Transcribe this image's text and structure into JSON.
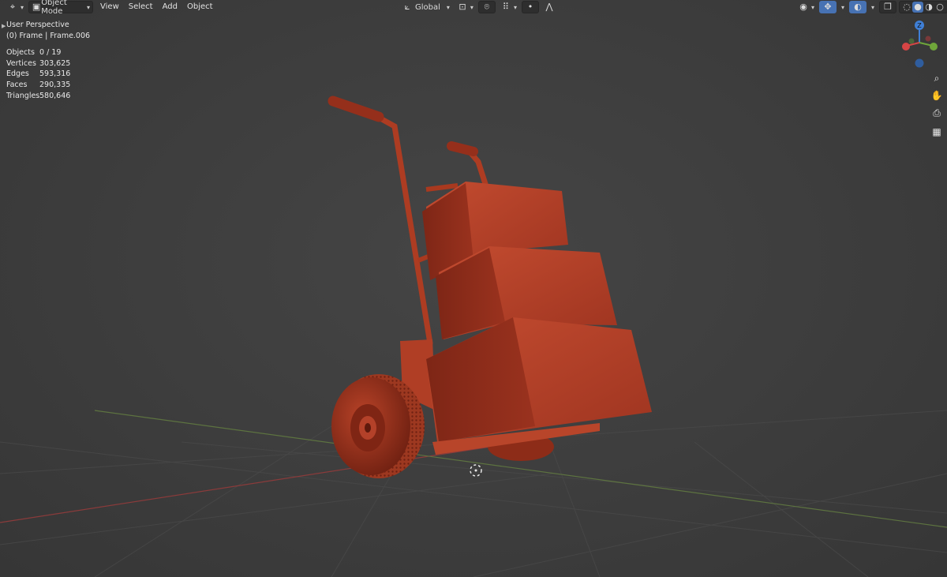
{
  "header": {
    "editor_type_icon": "view3d-icon",
    "mode": {
      "icon": "object-mode-icon",
      "label": "Object Mode"
    },
    "menus": [
      "View",
      "Select",
      "Add",
      "Object"
    ],
    "transform_orientation": {
      "icon": "orientation-icon",
      "label": "Global"
    },
    "icons_center": [
      "pivot-icon",
      "snap-icon",
      "snap-increment-icon",
      "proportional-edit-icon",
      "falloff-icon"
    ],
    "icons_right": [
      "visibility-icon",
      "gizmo-icon",
      "overlay-icon",
      "xray-icon",
      "wireframe-shading-icon",
      "solid-shading-icon",
      "material-shading-icon",
      "rendered-shading-icon"
    ]
  },
  "viewport_overlay": {
    "view_name": "User Perspective",
    "collection": "(0) Frame | Frame.006",
    "stats": [
      {
        "label": "Objects",
        "value": "0 / 19"
      },
      {
        "label": "Vertices",
        "value": "303,625"
      },
      {
        "label": "Edges",
        "value": "593,316"
      },
      {
        "label": "Faces",
        "value": "290,335"
      },
      {
        "label": "Triangles",
        "value": "580,646"
      }
    ]
  },
  "gizmo": {
    "axis_z": "Z",
    "axis_y": "Y",
    "axis_x": "X"
  },
  "nav_buttons": [
    "zoom-icon",
    "pan-hand-icon",
    "camera-view-icon",
    "ortho-grid-icon"
  ],
  "colors": {
    "background": "#3c3c3c",
    "model": "#b5432a",
    "axis_x": "#d64545",
    "axis_y": "#6fa63a",
    "axis_z": "#3f7fd6"
  }
}
